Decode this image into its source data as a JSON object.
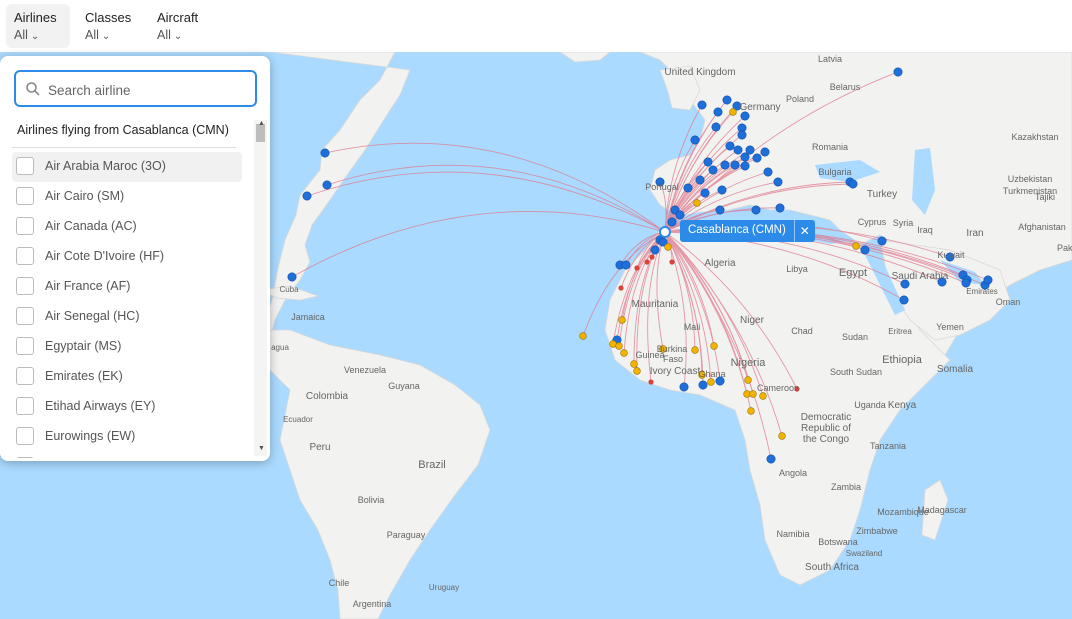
{
  "filters": [
    {
      "label": "Airlines",
      "value": "All"
    },
    {
      "label": "Classes",
      "value": "All"
    },
    {
      "label": "Aircraft",
      "value": "All"
    }
  ],
  "search": {
    "placeholder": "Search airline"
  },
  "list_heading": "Airlines flying from Casablanca (CMN)",
  "airlines": [
    "Air Arabia Maroc (3O)",
    "Air Cairo (SM)",
    "Air Canada (AC)",
    "Air Cote D'Ivoire (HF)",
    "Air France (AF)",
    "Air Senegal (HC)",
    "Egyptair (MS)",
    "Emirates (EK)",
    "Etihad Airways (EY)",
    "Eurowings (EW)"
  ],
  "hub_tooltip": {
    "label": "Casablanca (CMN)",
    "close": "✕"
  },
  "map_labels": [
    "United Kingdom",
    "Latvia",
    "Belarus",
    "Germany",
    "Poland",
    "Kazakhstan",
    "Romania",
    "Uzbekistan",
    "Turkmenistan",
    "Tajiki",
    "Bulgaria",
    "Turkey",
    "Portugal",
    "Cyprus",
    "Syria",
    "Iraq",
    "Iran",
    "Afghanistan",
    "Pakis",
    "Kuwait",
    "Algeria",
    "Libya",
    "Egypt",
    "Saudi Arabia",
    "Emirates",
    "Oman",
    "Yemen",
    "Mauritania",
    "Mali",
    "Niger",
    "Chad",
    "Sudan",
    "Eritrea",
    "Ethiopia",
    "Guinea",
    "Burkina",
    "Faso",
    "Ivory Coast",
    "Ghana",
    "Nigeria",
    "Cameroon",
    "South Sudan",
    "Somalia",
    "Uganda",
    "Kenya",
    "Democratic",
    "Republic of",
    "the Congo",
    "Tanzania",
    "Angola",
    "Zambia",
    "Mozambique",
    "Madagascar",
    "Namibia",
    "Botswana",
    "Zimbabwe",
    "Swaziland",
    "South Africa",
    "Cuba",
    "Jamaica",
    "agua",
    "Venezuela",
    "Guyana",
    "Colombia",
    "Ecuador",
    "Peru",
    "Brazil",
    "Bolivia",
    "Paraguay",
    "Chile",
    "Argentina",
    "Uruguay"
  ],
  "colors": {
    "ocean": "#aadaff",
    "land": "#f2f2f0",
    "route": "#e0788c",
    "airport_blue": "#1e6fd9",
    "airport_yellow": "#f0b400",
    "airport_red": "#d9443a",
    "accent": "#2c8be8"
  },
  "icons": {
    "search": "search-icon",
    "chevron": "chevron-down-icon",
    "close": "close-icon"
  }
}
